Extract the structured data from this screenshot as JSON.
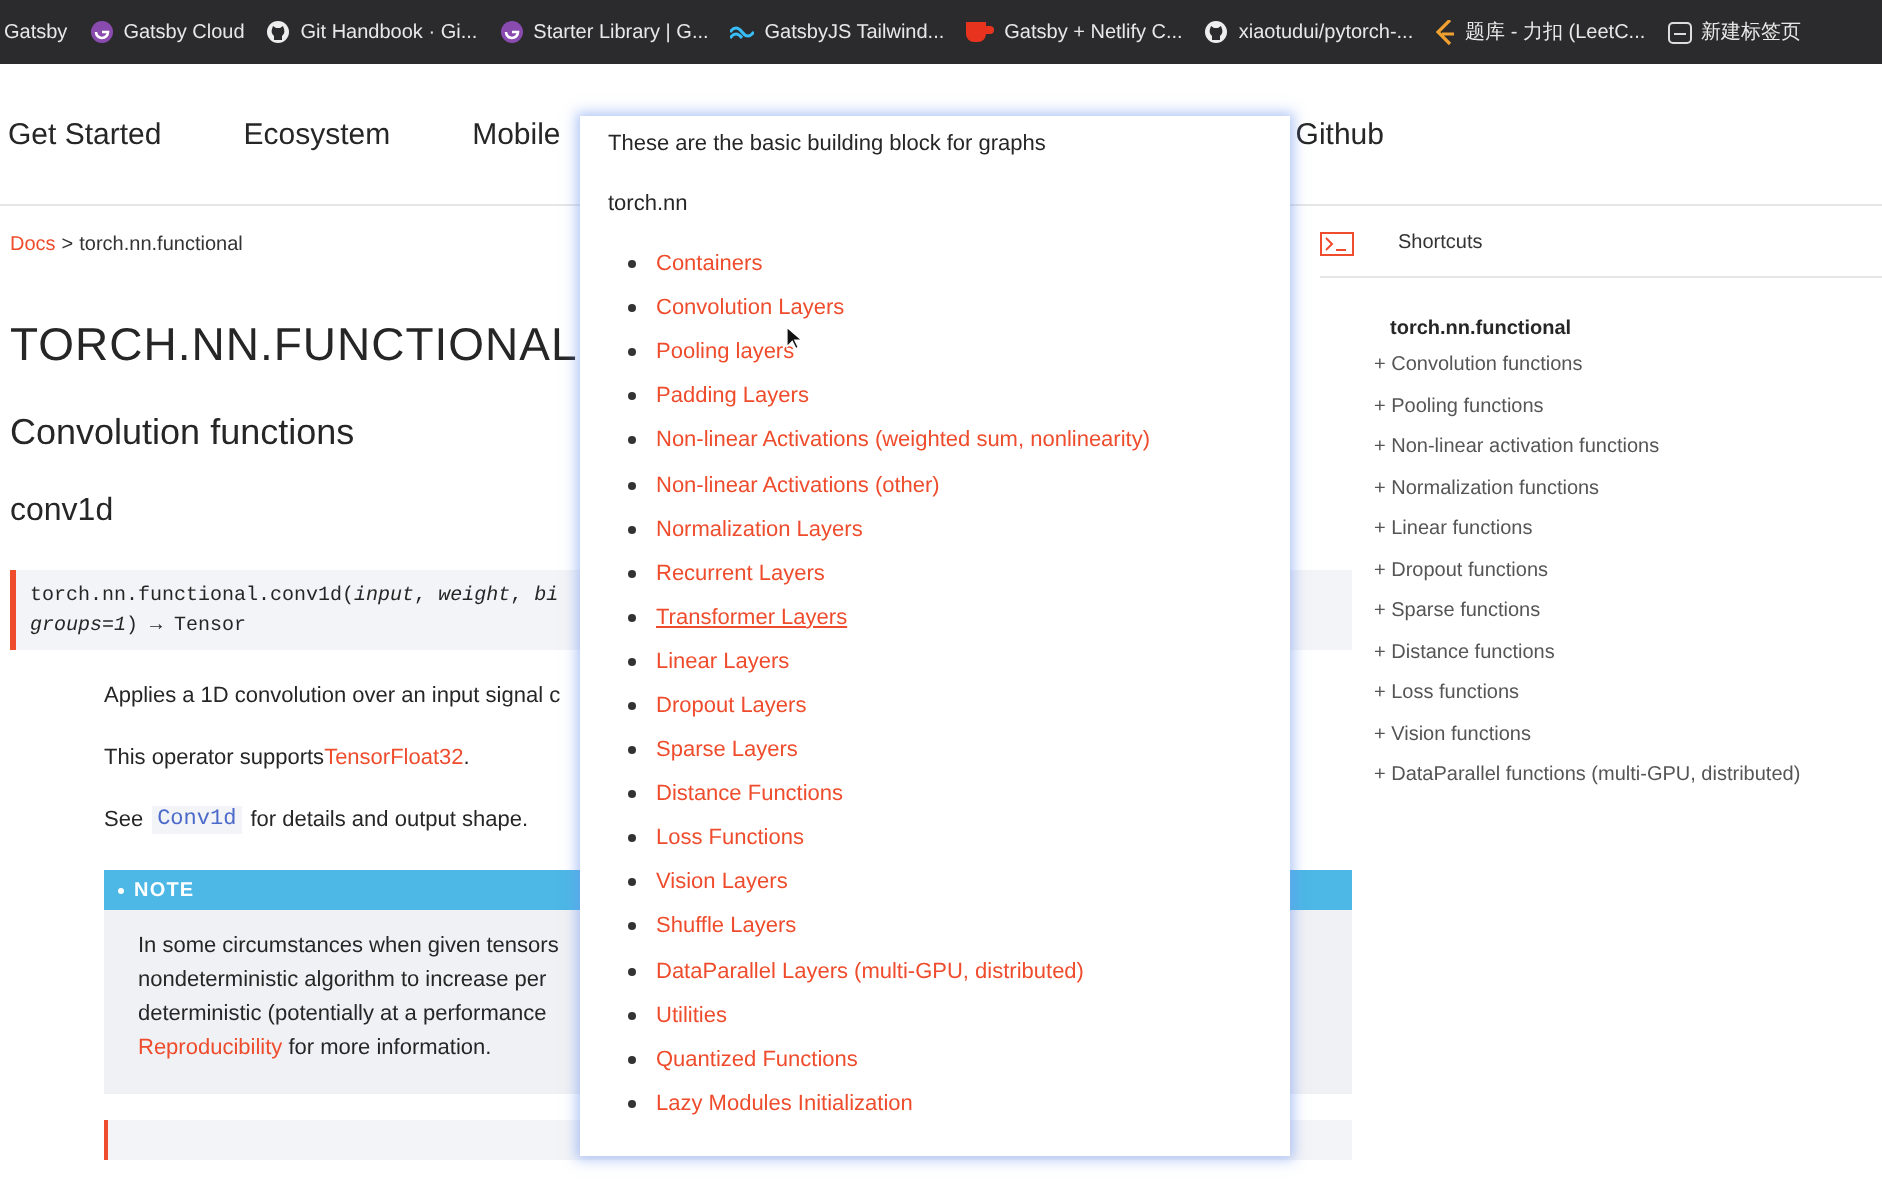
{
  "bookmarks": [
    {
      "label": "Gatsby"
    },
    {
      "label": "Gatsby Cloud"
    },
    {
      "label": "Git Handbook · Gi..."
    },
    {
      "label": "Starter Library | G..."
    },
    {
      "label": "GatsbyJS Tailwind..."
    },
    {
      "label": "Gatsby + Netlify C..."
    },
    {
      "label": "xiaotudui/pytorch-..."
    },
    {
      "label": "题库 - 力扣 (LeetC..."
    },
    {
      "label": "新建标签页"
    }
  ],
  "nav": {
    "items": [
      "Get Started",
      "Ecosystem",
      "Mobile"
    ],
    "right": "Github"
  },
  "breadcrumb": {
    "root": "Docs",
    "separator": ">",
    "current": "torch.nn.functional"
  },
  "page": {
    "title": "TORCH.NN.FUNCTIONAL",
    "section": "Convolution functions",
    "function": "conv1d",
    "signature": [
      "torch.nn.functional.conv1d(*input*, *weight*, *bi*",
      "*groups=1*) → Tensor"
    ],
    "paragraphs": [
      [
        {
          "text": "Applies a 1D convolution over an input signal c",
          "kind": "plain"
        }
      ],
      [
        {
          "text": "This operator supports ",
          "kind": "plain"
        },
        {
          "text": "TensorFloat32",
          "kind": "link"
        },
        {
          "text": ".",
          "kind": "plain"
        }
      ],
      [
        {
          "text": "See ",
          "kind": "plain"
        },
        {
          "text": "Conv1d",
          "kind": "code"
        },
        {
          "text": " for details and output shape.",
          "kind": "plain"
        }
      ]
    ],
    "note": {
      "label": "NOTE",
      "lines": [
        "In some circumstances when given tensors",
        "nondeterministic algorithm to increase per",
        "deterministic (potentially at a performance"
      ],
      "link": "Reproducibility",
      "link_tail": " for more information."
    }
  },
  "sidebar": {
    "shortcuts": "Shortcuts",
    "root": "torch.nn.functional",
    "items": [
      "Convolution functions",
      "Pooling functions",
      "Non-linear activation functions",
      "Normalization functions",
      "Linear functions",
      "Dropout functions",
      "Sparse functions",
      "Distance functions",
      "Loss functions",
      "Vision functions",
      "DataParallel functions (multi-GPU, distributed)"
    ],
    "expander": "+"
  },
  "popup": {
    "intro": "These are the basic building block for graphs",
    "heading": "torch.nn",
    "links": [
      {
        "label": "Containers",
        "hovered": false
      },
      {
        "label": "Convolution Layers",
        "hovered": false
      },
      {
        "label": "Pooling layers",
        "hovered": false
      },
      {
        "label": "Padding Layers",
        "hovered": false
      },
      {
        "label": "Non-linear Activations (weighted sum, nonlinearity)",
        "hovered": false
      },
      {
        "label": "Non-linear Activations (other)",
        "hovered": false
      },
      {
        "label": "Normalization Layers",
        "hovered": false
      },
      {
        "label": "Recurrent Layers",
        "hovered": false
      },
      {
        "label": "Transformer Layers",
        "hovered": true
      },
      {
        "label": "Linear Layers",
        "hovered": false
      },
      {
        "label": "Dropout Layers",
        "hovered": false
      },
      {
        "label": "Sparse Layers",
        "hovered": false
      },
      {
        "label": "Distance Functions",
        "hovered": false
      },
      {
        "label": "Loss Functions",
        "hovered": false
      },
      {
        "label": "Vision Layers",
        "hovered": false
      },
      {
        "label": "Shuffle Layers",
        "hovered": false
      },
      {
        "label": "DataParallel Layers (multi-GPU, distributed)",
        "hovered": false
      },
      {
        "label": "Utilities",
        "hovered": false
      },
      {
        "label": "Quantized Functions",
        "hovered": false
      },
      {
        "label": "Lazy Modules Initialization",
        "hovered": false
      }
    ]
  }
}
